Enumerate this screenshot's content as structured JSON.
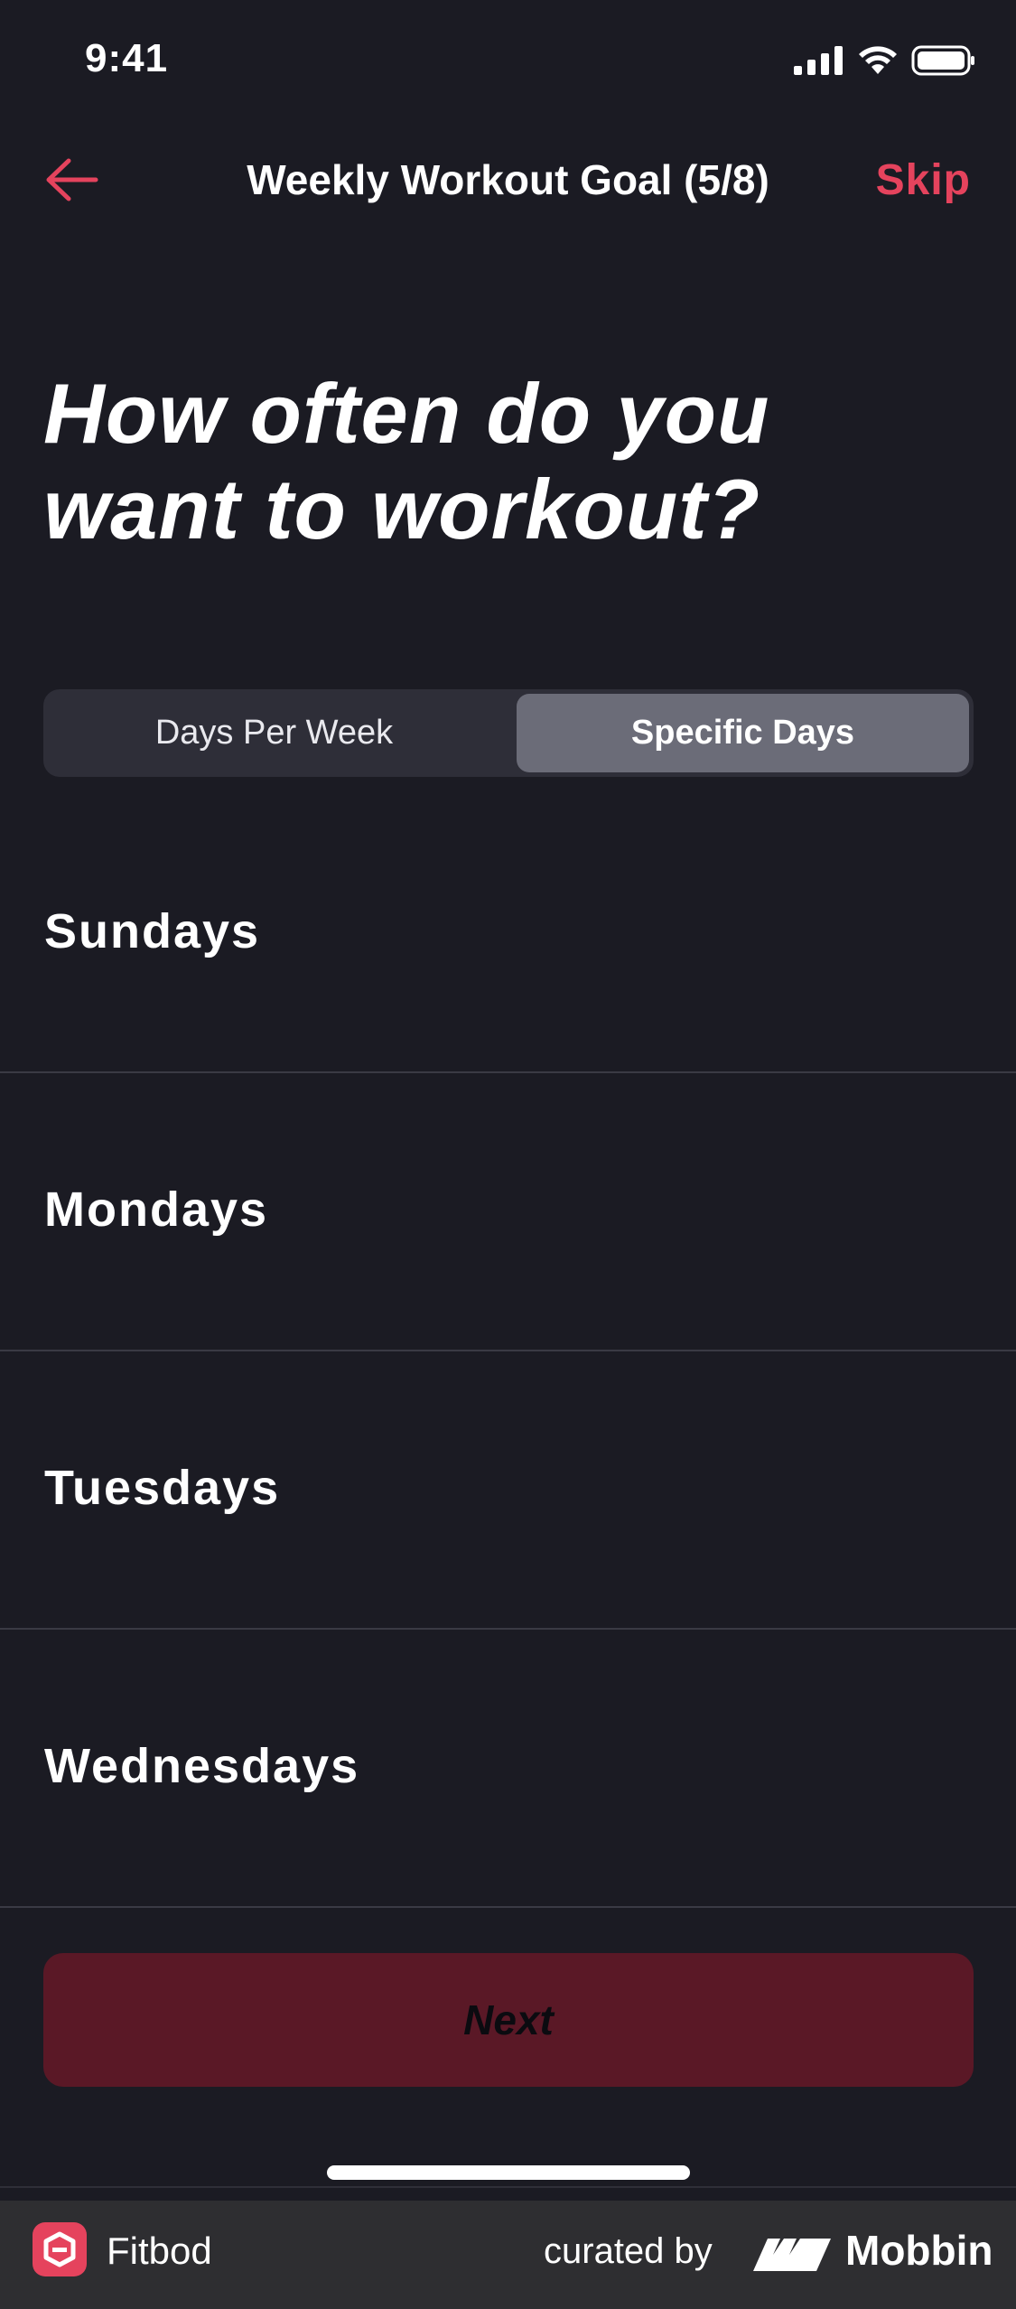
{
  "status_bar": {
    "time": "9:41"
  },
  "nav": {
    "title": "Weekly Workout Goal (5/8)",
    "skip_label": "Skip"
  },
  "headline": {
    "line1": "How often do you",
    "line2": "want to workout?"
  },
  "segmented": {
    "options": [
      "Days Per Week",
      "Specific Days"
    ],
    "selected": "Specific Days"
  },
  "days": [
    "Sundays",
    "Mondays",
    "Tuesdays",
    "Wednesdays"
  ],
  "next_label": "Next",
  "footer": {
    "app_name": "Fitbod",
    "curated_by": "curated by",
    "brand": "Mobbin"
  },
  "colors": {
    "background": "#1b1b23",
    "accent": "#e5435d",
    "next_button": "#5a1826"
  }
}
